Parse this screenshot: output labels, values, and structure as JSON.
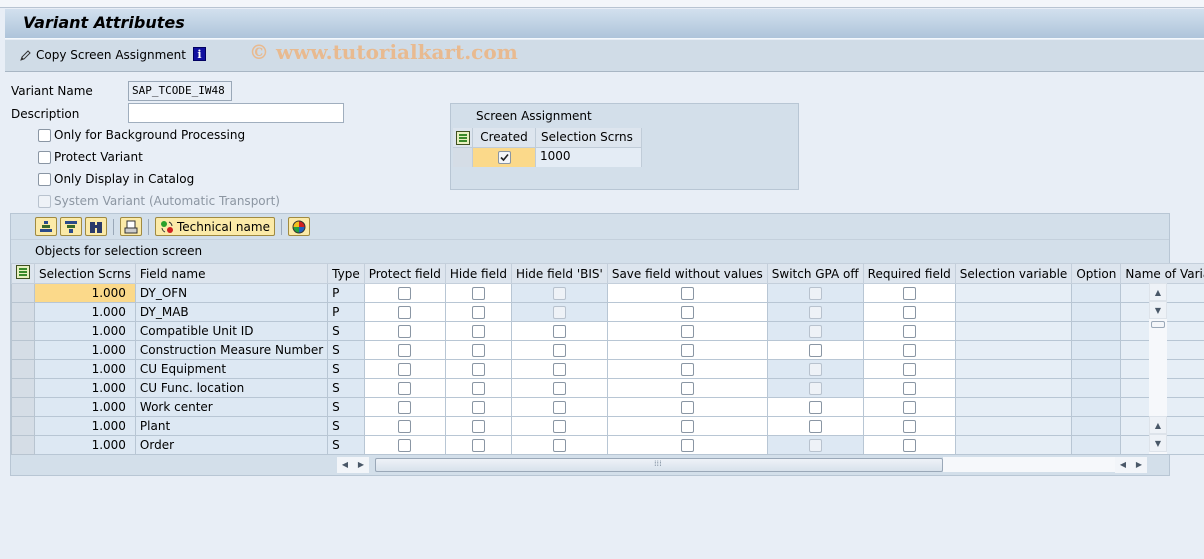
{
  "window": {
    "title": "Variant Attributes"
  },
  "app_toolbar": {
    "copy_screen_assignment": "Copy Screen Assignment",
    "info_icon_glyph": "i",
    "watermark": "© www.tutorialkart.com"
  },
  "form": {
    "variant_name_label": "Variant Name",
    "variant_name_value": "SAP_TCODE_IW48",
    "description_label": "Description",
    "description_value": "",
    "checkboxes": [
      {
        "label": "Only for Background Processing",
        "checked": false,
        "enabled": true
      },
      {
        "label": "Protect Variant",
        "checked": false,
        "enabled": true
      },
      {
        "label": "Only Display in Catalog",
        "checked": false,
        "enabled": true
      },
      {
        "label": "System Variant (Automatic Transport)",
        "checked": false,
        "enabled": false
      }
    ]
  },
  "screen_assignment": {
    "title": "Screen Assignment",
    "columns": [
      "Created",
      "Selection Scrns"
    ],
    "rows": [
      {
        "created": true,
        "selection_scrns": "1000"
      }
    ]
  },
  "table_toolbar": {
    "technical_name": "Technical name",
    "icons": [
      "sort-ascending-icon",
      "filter-icon",
      "find-icon",
      "print-icon",
      "technical-name-icon",
      "color-legend-icon"
    ]
  },
  "objects_table": {
    "title": "Objects for selection screen",
    "columns": [
      "Selection Scrns",
      "Field name",
      "Type",
      "Protect field",
      "Hide field",
      "Hide field 'BIS'",
      "Save field without values",
      "Switch GPA off",
      "Required field",
      "Selection variable",
      "Option",
      "Name of Variable (Input"
    ],
    "rows": [
      {
        "scrn": "1.000",
        "field": "DY_OFN",
        "type": "P",
        "protect": false,
        "hide": false,
        "hide_bis": false,
        "save_wo": false,
        "gpa_off": false,
        "required": false,
        "sel_var": "",
        "option": "",
        "var_name": ""
      },
      {
        "scrn": "1.000",
        "field": "DY_MAB",
        "type": "P",
        "protect": false,
        "hide": false,
        "hide_bis": false,
        "save_wo": false,
        "gpa_off": false,
        "required": false,
        "sel_var": "",
        "option": "",
        "var_name": ""
      },
      {
        "scrn": "1.000",
        "field": "Compatible Unit ID",
        "type": "S",
        "protect": false,
        "hide": false,
        "hide_bis": false,
        "save_wo": false,
        "gpa_off": false,
        "required": false,
        "sel_var": "",
        "option": "",
        "var_name": ""
      },
      {
        "scrn": "1.000",
        "field": "Construction Measure Number",
        "type": "S",
        "protect": false,
        "hide": false,
        "hide_bis": false,
        "save_wo": false,
        "gpa_off": false,
        "required": false,
        "sel_var": "",
        "option": "",
        "var_name": ""
      },
      {
        "scrn": "1.000",
        "field": "CU Equipment",
        "type": "S",
        "protect": false,
        "hide": false,
        "hide_bis": false,
        "save_wo": false,
        "gpa_off": false,
        "required": false,
        "sel_var": "",
        "option": "",
        "var_name": ""
      },
      {
        "scrn": "1.000",
        "field": "CU Func. location",
        "type": "S",
        "protect": false,
        "hide": false,
        "hide_bis": false,
        "save_wo": false,
        "gpa_off": false,
        "required": false,
        "sel_var": "",
        "option": "",
        "var_name": ""
      },
      {
        "scrn": "1.000",
        "field": "Work center",
        "type": "S",
        "protect": false,
        "hide": false,
        "hide_bis": false,
        "save_wo": false,
        "gpa_off": false,
        "required": false,
        "sel_var": "",
        "option": "",
        "var_name": ""
      },
      {
        "scrn": "1.000",
        "field": "Plant",
        "type": "S",
        "protect": false,
        "hide": false,
        "hide_bis": false,
        "save_wo": false,
        "gpa_off": false,
        "required": false,
        "sel_var": "",
        "option": "",
        "var_name": ""
      },
      {
        "scrn": "1.000",
        "field": "Order",
        "type": "S",
        "protect": false,
        "hide": false,
        "hide_bis": false,
        "save_wo": false,
        "gpa_off": false,
        "required": false,
        "sel_var": "",
        "option": "",
        "var_name": ""
      }
    ],
    "readonly_hide_bis_rows": [
      0,
      1
    ],
    "readonly_gpa_off_rows": [
      0,
      1,
      2,
      4,
      5,
      8
    ]
  }
}
